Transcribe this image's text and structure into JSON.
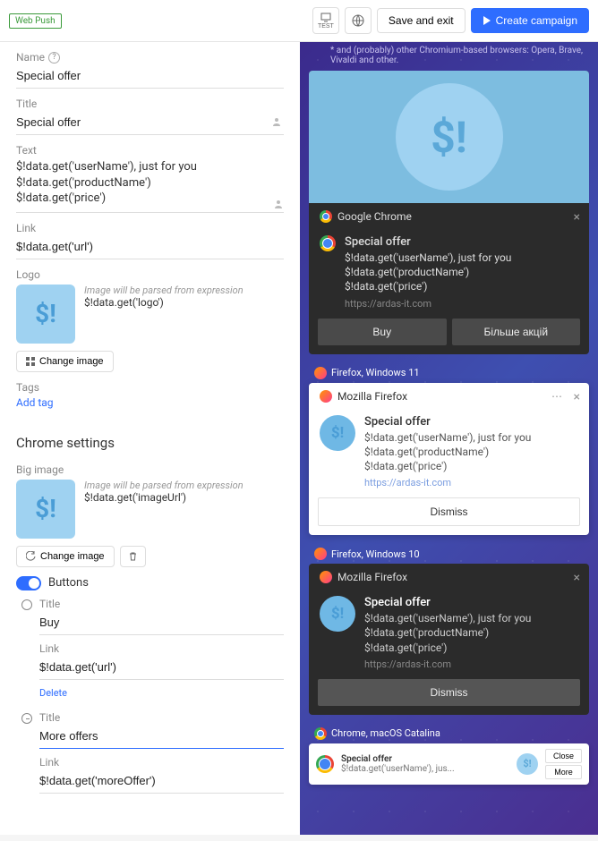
{
  "topbar": {
    "badge": "Web Push",
    "test": "TEST",
    "save": "Save and exit",
    "create": "Create campaign"
  },
  "form": {
    "name_label": "Name",
    "name_value": "Special offer",
    "title_label": "Title",
    "title_value": "Special offer",
    "text_label": "Text",
    "text_value": "$!data.get('userName'), just for you\n$!data.get('productName')\n$!data.get('price')",
    "link_label": "Link",
    "link_value": "$!data.get('url')",
    "logo_label": "Logo",
    "img_parsed": "Image will be parsed from expression",
    "logo_expr": "$!data.get('logo')",
    "change_image": "Change image",
    "tags_label": "Tags",
    "add_tag": "Add tag"
  },
  "chrome": {
    "section": "Chrome settings",
    "bigimg_label": "Big image",
    "bigimg_expr": "$!data.get('imageUrl')",
    "buttons_label": "Buttons",
    "btn1_title_label": "Title",
    "btn1_title": "Buy",
    "btn1_link_label": "Link",
    "btn1_link": "$!data.get('url')",
    "delete": "Delete",
    "btn2_title_label": "Title",
    "btn2_title": "More offers",
    "btn2_link_label": "Link",
    "btn2_link": "$!data.get('moreOffer')"
  },
  "preview": {
    "chromium_note": "* and (probably) other Chromium-based browsers: Opera, Brave, Vivaldi and other.",
    "chrome_name": "Google Chrome",
    "firefox_name": "Mozilla Firefox",
    "title": "Special offer",
    "text": "$!data.get('userName'), just for you\n$!data.get('productName')\n$!data.get('price')",
    "url": "https://ardas-it.com",
    "buy": "Buy",
    "more": "Більше акцій",
    "dismiss": "Dismiss",
    "firefox_w11": "Firefox, Windows 11",
    "firefox_w10": "Firefox, Windows 10",
    "chrome_mac": "Chrome, macOS Catalina",
    "mac_text": "$!data.get('userName'), jus...",
    "close": "Close",
    "more_btn": "More"
  }
}
